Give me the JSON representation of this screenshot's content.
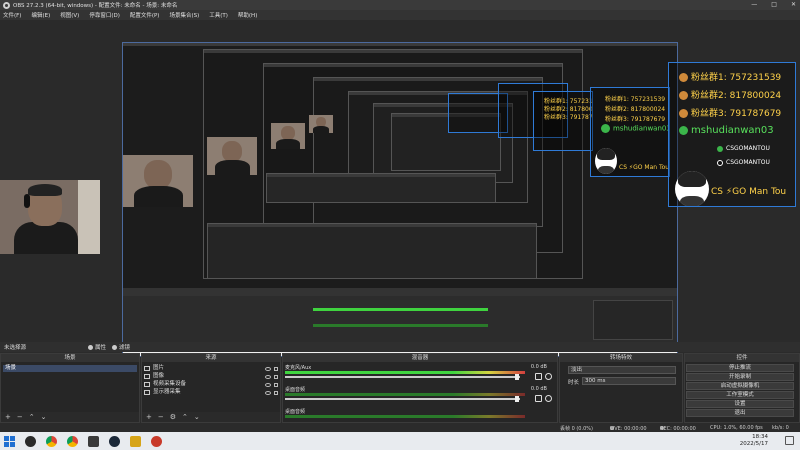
{
  "window": {
    "title": "OBS 27.2.3 (64-bit, windows) - 配置文件: 未命名 - 场景: 未命名",
    "controls": [
      "—",
      "□",
      "✕"
    ]
  },
  "menu": [
    "文件(F)",
    "编辑(E)",
    "视图(V)",
    "停靠窗口(D)",
    "配置文件(P)",
    "场景集合(S)",
    "工具(T)",
    "帮助(H)"
  ],
  "overlay": {
    "fan_group_1": "粉丝群1: 757231539",
    "fan_group_2": "粉丝群2: 817800024",
    "fan_group_3": "粉丝群3: 791787679",
    "wechat": "mshudianwan03",
    "tiktok_1": "CSGOMANTOU",
    "tiktok_2": "CSGOMANTOU",
    "signature": "CS ⚡GO Man Tou",
    "mid_wechat": "mshudianwan03",
    "mid_signature": "CS ⚡GO Man Tou",
    "mid_fan_1": "粉丝群1: 757231539",
    "mid_fan_2": "粉丝群2: 817800024",
    "mid_fan_3": "粉丝群3: 791787679"
  },
  "toolbar": {
    "scene_name": "未选择源",
    "properties": "属性",
    "filters": "滤镜"
  },
  "docks": {
    "scenes": {
      "title": "场景",
      "items": [
        "场景"
      ]
    },
    "sources": {
      "title": "来源",
      "items": [
        {
          "name": "图片",
          "icon": "image-icon"
        },
        {
          "name": "图像",
          "icon": "image-icon"
        },
        {
          "name": "视频采集设备",
          "icon": "camera-icon"
        },
        {
          "name": "显示器采集",
          "icon": "monitor-icon"
        }
      ]
    },
    "mixer": {
      "title": "混音器",
      "channels": [
        {
          "name": "麦克风/Aux",
          "db": "0.0 dB",
          "active": true
        },
        {
          "name": "桌面音频",
          "db": "0.0 dB",
          "active": false
        },
        {
          "name": "桌面音频",
          "db": "",
          "active": false
        }
      ]
    },
    "transitions": {
      "title": "转场特效",
      "type": "淡出",
      "duration_label": "时长",
      "duration_value": "300 ms"
    },
    "controls": {
      "title": "控件",
      "buttons": [
        "停止推流",
        "开始录制",
        "启动虚拟摄像机",
        "工作室模式",
        "设置",
        "退出"
      ]
    }
  },
  "status": {
    "dropped": "丢帧 0 (0.0%)",
    "live": "LIVE: 00:00:00",
    "rec": "REC: 00:00:00",
    "cpu": "CPU: 1.0%, 60.00 fps",
    "bitrate": "kb/s: 0"
  },
  "taskbar": {
    "time": "18:34",
    "date": "2022/5/17",
    "apps": [
      "windows-start-icon",
      "search-icon",
      "chrome-icon",
      "chrome-icon",
      "app-icon",
      "steam-icon",
      "app-icon",
      "obs-icon"
    ]
  },
  "colors": {
    "accent": "#2f7ad6",
    "overlay_text": "#ffd24a",
    "wechat_green": "#58e05c",
    "meter_green": "#3fd33f"
  }
}
